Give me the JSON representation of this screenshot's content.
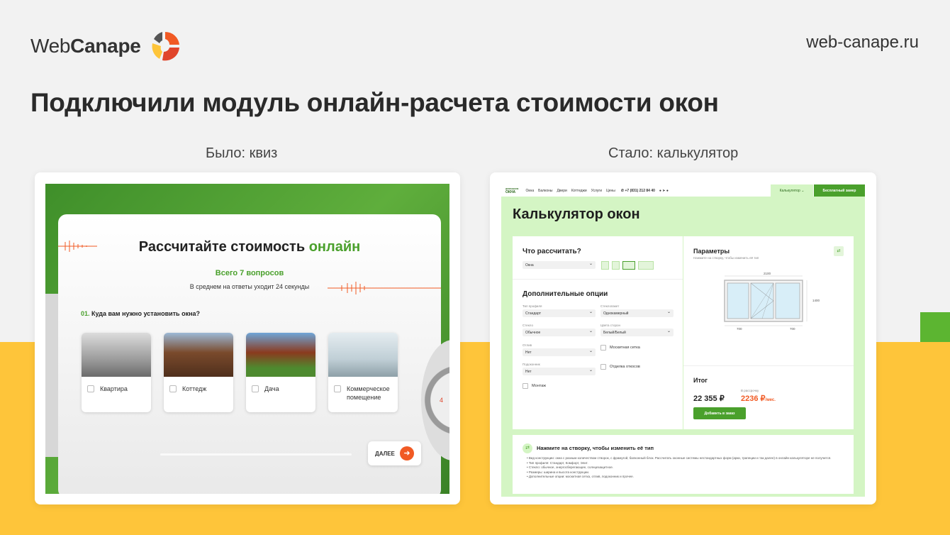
{
  "brand": {
    "logo_web": "Web",
    "logo_canape": "Canape",
    "site_url": "web-canape.ru",
    "colors": {
      "green": "#5cb531",
      "yellow": "#fec53a",
      "orange": "#f15a24",
      "dark": "#2a2a2a"
    }
  },
  "headline": "Подключили модуль онлайн-расчета стоимости окон",
  "captions": {
    "before": "Было: квиз",
    "after": "Стало: калькулятор"
  },
  "quiz": {
    "title_main": "Рассчитайте стоимость ",
    "title_accent": "онлайн",
    "subtitle": "Всего 7 вопросов",
    "subtext": "В среднем на ответы уходит 24 секунды",
    "question_num": "01.",
    "question_text": " Куда вам нужно установить окна?",
    "options": [
      {
        "label": "Квартира",
        "icon": "apartment-photo"
      },
      {
        "label": "Коттедж",
        "icon": "cottage-photo"
      },
      {
        "label": "Дача",
        "icon": "country-house-photo"
      },
      {
        "label": "Коммерческое помещение",
        "icon": "commercial-photo"
      }
    ],
    "next_label": "ДАЛЕЕ",
    "stopwatch_digit": "4"
  },
  "calculator": {
    "nav": {
      "logo_top": "ДОМАШНИЕ",
      "logo_bottom": "ОКНА",
      "links": [
        "Окна",
        "Балконы",
        "Двери",
        "Коттеджи",
        "Услуги",
        "Цены"
      ],
      "phone": "+7 (831) 212 84 40",
      "calc_label": "Калькулятор",
      "cta_label": "Бесплатный замер"
    },
    "title": "Калькулятор окон",
    "what_title": "Что рассчитать?",
    "what_select": "Окна",
    "options_title": "Дополнительные опции",
    "fields": [
      {
        "label": "Тип профиля",
        "value": "Стандарт"
      },
      {
        "label": "Стеклопакет",
        "value": "Однокамерный"
      },
      {
        "label": "Стекло",
        "value": "Обычное"
      },
      {
        "label": "Цвета сторон",
        "value": "Белый/Белый"
      },
      {
        "label": "Отлив",
        "value": "Нет"
      },
      {
        "label": "Подоконник",
        "value": "Нет"
      }
    ],
    "checkboxes": {
      "net": "Москитная сетка",
      "otkos": "Отделка откосов",
      "montazh": "Монтаж"
    },
    "params_title": "Параметры",
    "params_hint": "Нажмите на створку, чтобы изменить её тип",
    "dims": {
      "width": "2100",
      "height": "1400",
      "sash_left": "700",
      "sash_right": "700"
    },
    "total_title": "Итог",
    "price": "22 355 ₽",
    "installment_label": "В рассрочку",
    "installment": "2236 ₽",
    "installment_unit": "/мес.",
    "add_label": "Добавить в заказ",
    "hint_title": "Нажмите на створку, чтобы изменить её тип",
    "hint_items": [
      "Вид конструкции: окна с разным количеством створок, с фрамугой, балконный блок. Рассчитать оконные системы нестандартных форм (арки, трапеции и так далее) в онлайн калькуляторе не получится.",
      "Тип профиля: Стандарт, Комфорт, Элит.",
      "Стекло: обычное, энергосберегающее, солнцезащитное.",
      "Размеры: ширина и высота конструкции.",
      "Дополнительные опции: москитная сетка, отлив, подоконник и прочее."
    ]
  }
}
